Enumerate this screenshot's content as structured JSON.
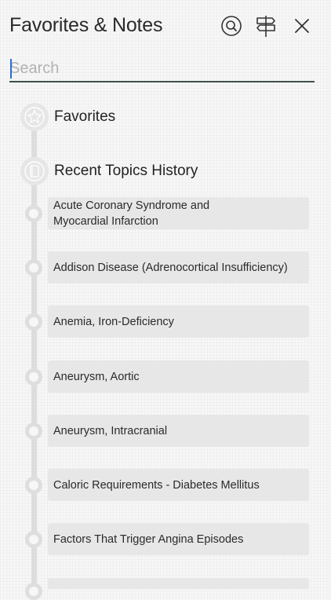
{
  "header": {
    "title": "Favorites & Notes",
    "icons": [
      "search-icon",
      "signpost-icon",
      "close-icon"
    ]
  },
  "search": {
    "placeholder": "Search",
    "value": ""
  },
  "sections": {
    "favorites": {
      "label": "Favorites",
      "icon": "star-icon"
    },
    "history": {
      "label": "Recent Topics History",
      "icon": "book-icon"
    }
  },
  "history_items": [
    {
      "label": "Acute Coronary Syndrome and\nMyocardial Infarction"
    },
    {
      "label": "Addison Disease (Adrenocortical Insufficiency)"
    },
    {
      "label": "Anemia, Iron-Deficiency"
    },
    {
      "label": "Aneurysm, Aortic"
    },
    {
      "label": "Aneurysm, Intracranial"
    },
    {
      "label": "Caloric Requirements - Diabetes Mellitus"
    },
    {
      "label": "Factors That Trigger Angina Episodes"
    }
  ],
  "colors": {
    "accent_underline": "#3f4e4b",
    "caret": "#2b6fd6",
    "item_bg": "#e7e7e7",
    "timeline": "#dddddd"
  }
}
